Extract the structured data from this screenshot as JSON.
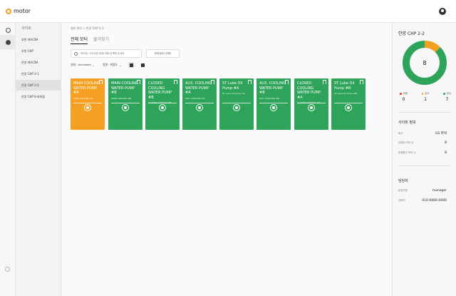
{
  "app": {
    "logo_text": "motor"
  },
  "sidebar": {
    "title": "사이트",
    "items": [
      {
        "label": "부천 파워 DH",
        "active": false
      },
      {
        "label": "부천 CHP",
        "active": false
      },
      {
        "label": "안양 파워 DH",
        "active": false
      },
      {
        "label": "안양 CHP 2-1",
        "active": false
      },
      {
        "label": "안양 CHP 2-2",
        "active": true
      },
      {
        "label": "안양 CHP 6-파워동",
        "active": false
      }
    ]
  },
  "main": {
    "breadcrumb": "설비 관리 > 안양 CHP 2-2",
    "tabs": [
      {
        "label": "전체 모터",
        "active": true
      },
      {
        "label": "즐겨찾기",
        "active": false
      }
    ],
    "search_placeholder": "모터명, 사이트명 등에 대해 검색해 주세요",
    "status_button_label": "부하상태 (전체)",
    "filter_state": "상태 : Activated",
    "filter_sort": "정렬 : 최협도",
    "cards": [
      {
        "title": "MAIN COOLING WATER PUMP #A",
        "subtitle": "MAIN COOLING #A",
        "color": "orange",
        "status_color": "#f5a023"
      },
      {
        "title": "MAIN COOLING WATER PUMP #B",
        "subtitle": "MAIN COOLING #B",
        "color": "green",
        "status_color": "#2ea35a"
      },
      {
        "title": "CLOSED COOLING WATER PUMP #B",
        "subtitle": "CLOSED COOLING #B",
        "color": "green",
        "status_color": "#2ea35a"
      },
      {
        "title": "AUX. COOLING WATER PUMP #A",
        "subtitle": "AUX. COOLING #A",
        "color": "green",
        "status_color": "#2ea35a"
      },
      {
        "title": "ST Lube Oil Pump #A",
        "subtitle": "ST Lube Oil Pump #A",
        "color": "green",
        "status_color": "#2ea35a"
      },
      {
        "title": "AUX. COOLING WATER PUMP #B",
        "subtitle": "AUX. COOLING #B",
        "color": "green",
        "status_color": "#2ea35a"
      },
      {
        "title": "CLOSED COOLING WATER PUMP #A",
        "subtitle": "CLOSED COOLING #A",
        "color": "green",
        "status_color": "#2ea35a"
      },
      {
        "title": "ST Lube Oil Pump #B",
        "subtitle": "ST Lube Oil Pump #B",
        "color": "green",
        "status_color": "#2ea35a"
      }
    ]
  },
  "right_panel": {
    "title": "안양 CHP 2-2",
    "donut": {
      "center_value": "8",
      "segments": [
        {
          "label": "위험",
          "value": 0,
          "color": "#e53935"
        },
        {
          "label": "경고",
          "value": 1,
          "color": "#f5a023"
        },
        {
          "label": "정상",
          "value": 7,
          "color": "#2ea35a"
        }
      ]
    },
    "legend": [
      {
        "label": "위험",
        "count": "0",
        "color": "#e53935"
      },
      {
        "label": "경고",
        "count": "1",
        "color": "#f5a023"
      },
      {
        "label": "정상",
        "count": "7",
        "color": "#2ea35a"
      }
    ],
    "site_info": {
      "title": "사이트 정보",
      "rows": [
        {
          "key": "회사",
          "value": "GS 파워"
        },
        {
          "key": "내재된 모터 수",
          "value": "8"
        },
        {
          "key": "운행중인 모터 수",
          "value": "8"
        }
      ]
    },
    "manager": {
      "title": "담당자",
      "rows": [
        {
          "key": "담당자명",
          "value": "manager"
        },
        {
          "key": "연락처",
          "value": "010-0000-0000"
        }
      ]
    }
  },
  "colors": {
    "accent_orange": "#f5a023",
    "accent_green": "#2ea35a",
    "danger_red": "#e53935"
  }
}
